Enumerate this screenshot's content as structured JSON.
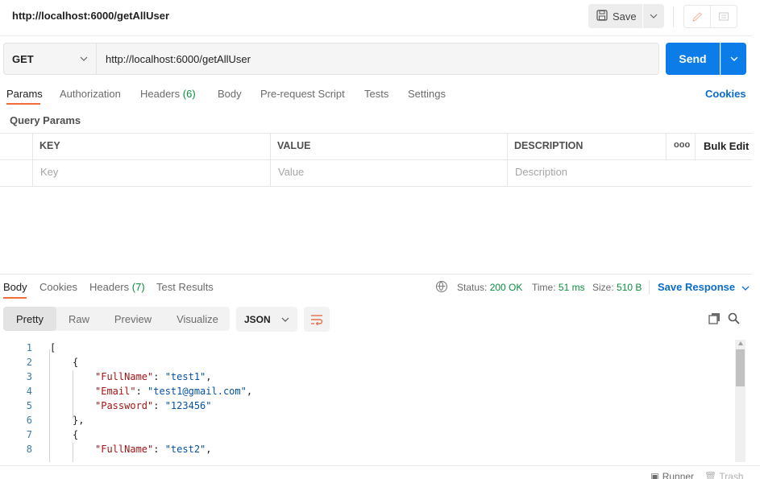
{
  "window": {
    "title": "http://localhost:6000/getAllUser"
  },
  "toolbar": {
    "save_label": "Save"
  },
  "request": {
    "method": "GET",
    "url": "http://localhost:6000/getAllUser",
    "send_label": "Send"
  },
  "request_tabs": {
    "params": "Params",
    "authorization": "Authorization",
    "headers": "Headers",
    "headers_count": "(6)",
    "body": "Body",
    "pre_request": "Pre-request Script",
    "tests": "Tests",
    "settings": "Settings",
    "cookies": "Cookies"
  },
  "query_params": {
    "title": "Query Params",
    "columns": {
      "key": "KEY",
      "value": "VALUE",
      "description": "DESCRIPTION"
    },
    "more": "ooo",
    "bulk_edit": "Bulk Edit",
    "placeholders": {
      "key": "Key",
      "value": "Value",
      "description": "Description"
    }
  },
  "response_tabs": {
    "body": "Body",
    "cookies": "Cookies",
    "headers": "Headers",
    "headers_count": "(7)",
    "test_results": "Test Results"
  },
  "response_status": {
    "status_label": "Status:",
    "status_value": "200 OK",
    "time_label": "Time:",
    "time_value": "51 ms",
    "size_label": "Size:",
    "size_value": "510 B",
    "save_response": "Save Response"
  },
  "view_modes": {
    "pretty": "Pretty",
    "raw": "Raw",
    "preview": "Preview",
    "visualize": "Visualize"
  },
  "format": "JSON",
  "code": {
    "line_numbers": [
      "1",
      "2",
      "3",
      "4",
      "5",
      "6",
      "7",
      "8"
    ],
    "lines": [
      {
        "text": "["
      },
      {
        "text": "{"
      },
      {
        "key": "\"FullName\"",
        "value": "\"test1\"",
        "trail": ","
      },
      {
        "key": "\"Email\"",
        "value": "\"test1@gmail.com\"",
        "trail": ","
      },
      {
        "key": "\"Password\"",
        "value": "\"123456\"",
        "trail": ""
      },
      {
        "text": "},"
      },
      {
        "text": "{"
      },
      {
        "key": "\"FullName\"",
        "value": "\"test2\"",
        "trail": ","
      }
    ]
  },
  "footer": {
    "runner": "Runner",
    "trash": "Trash"
  }
}
